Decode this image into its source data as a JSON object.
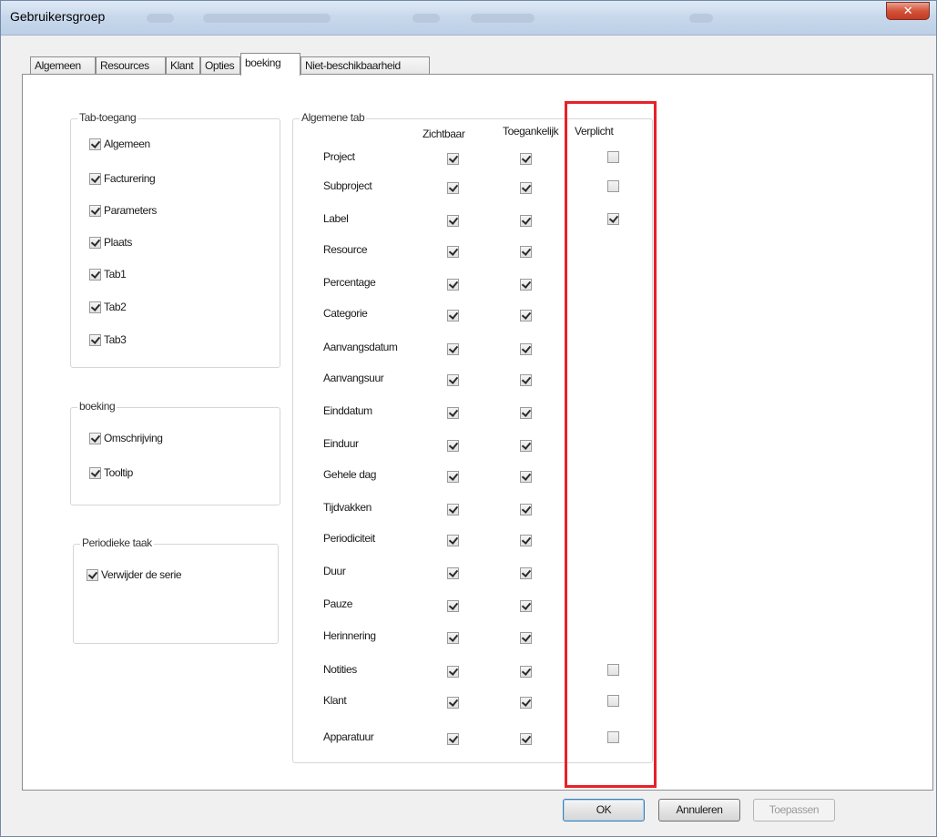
{
  "window": {
    "title": "Gebruikersgroep",
    "close_glyph": "✕"
  },
  "tabs": [
    "Algemeen",
    "Resources",
    "Klant",
    "Opties",
    "boeking",
    "Niet-beschikbaarheid"
  ],
  "tab_access": {
    "title": "Tab-toegang",
    "items": [
      {
        "label": "Algemeen",
        "checked": true
      },
      {
        "label": "Facturering",
        "checked": true
      },
      {
        "label": "Parameters",
        "checked": true
      },
      {
        "label": "Plaats",
        "checked": true
      },
      {
        "label": "Tab1",
        "checked": true
      },
      {
        "label": "Tab2",
        "checked": true
      },
      {
        "label": "Tab3",
        "checked": true
      }
    ]
  },
  "boeking_group": {
    "title": "boeking",
    "items": [
      {
        "label": "Omschrijving",
        "checked": true
      },
      {
        "label": "Tooltip",
        "checked": true
      }
    ]
  },
  "periodic_task": {
    "title": "Periodieke taak",
    "items": [
      {
        "label": "Verwijder de serie",
        "checked": true
      }
    ]
  },
  "general_tab": {
    "title": "Algemene tab",
    "columns": [
      "Zichtbaar",
      "Toegankelijk",
      "Verplicht"
    ],
    "rows": [
      {
        "label": "Project",
        "visible": true,
        "accessible": true,
        "required": false
      },
      {
        "label": "Subproject",
        "visible": true,
        "accessible": true,
        "required": false
      },
      {
        "label": "Label",
        "visible": true,
        "accessible": true,
        "required": true
      },
      {
        "label": "Resource",
        "visible": true,
        "accessible": true,
        "required": null
      },
      {
        "label": "Percentage",
        "visible": true,
        "accessible": true,
        "required": null
      },
      {
        "label": "Categorie",
        "visible": true,
        "accessible": true,
        "required": null
      },
      {
        "label": "Aanvangsdatum",
        "visible": true,
        "accessible": true,
        "required": null
      },
      {
        "label": "Aanvangsuur",
        "visible": true,
        "accessible": true,
        "required": null
      },
      {
        "label": "Einddatum",
        "visible": true,
        "accessible": true,
        "required": null
      },
      {
        "label": "Einduur",
        "visible": true,
        "accessible": true,
        "required": null
      },
      {
        "label": "Gehele dag",
        "visible": true,
        "accessible": true,
        "required": null
      },
      {
        "label": "Tijdvakken",
        "visible": true,
        "accessible": true,
        "required": null
      },
      {
        "label": "Periodiciteit",
        "visible": true,
        "accessible": true,
        "required": null
      },
      {
        "label": "Duur",
        "visible": true,
        "accessible": true,
        "required": null
      },
      {
        "label": "Pauze",
        "visible": true,
        "accessible": true,
        "required": null
      },
      {
        "label": "Herinnering",
        "visible": true,
        "accessible": true,
        "required": null
      },
      {
        "label": "Notities",
        "visible": true,
        "accessible": true,
        "required": false
      },
      {
        "label": "Klant",
        "visible": true,
        "accessible": true,
        "required": false
      },
      {
        "label": "Apparatuur",
        "visible": true,
        "accessible": true,
        "required": false
      }
    ]
  },
  "buttons": {
    "ok": "OK",
    "cancel": "Annuleren",
    "apply": "Toepassen"
  },
  "colors": {
    "highlight": "#e8202a"
  }
}
